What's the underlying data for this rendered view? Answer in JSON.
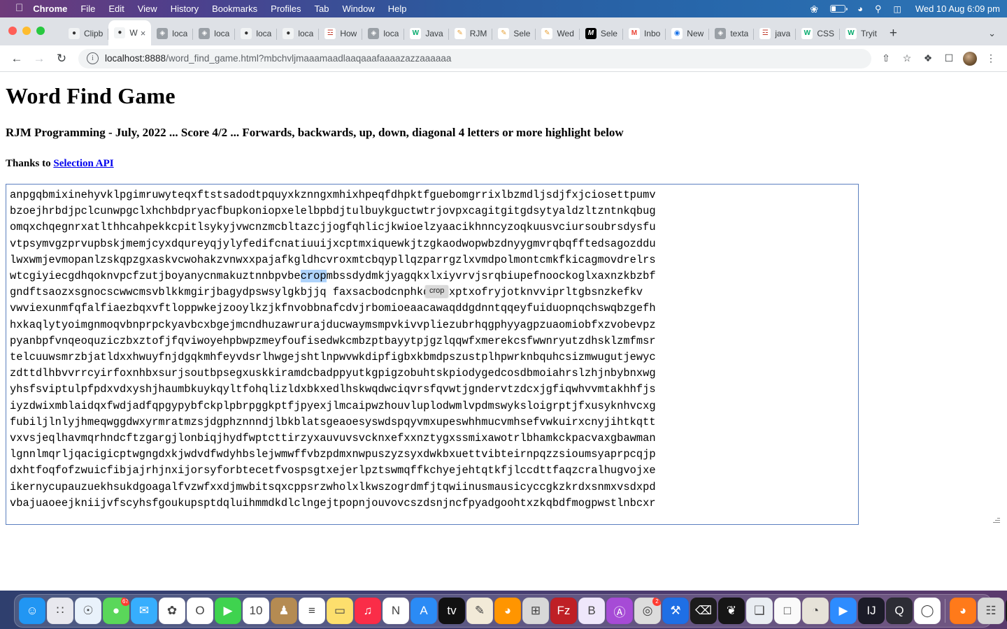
{
  "menubar": {
    "apple_icon": "apple-icon",
    "items": [
      {
        "label": "Chrome",
        "bold": true
      },
      {
        "label": "File",
        "bold": false
      },
      {
        "label": "Edit",
        "bold": false
      },
      {
        "label": "View",
        "bold": false
      },
      {
        "label": "History",
        "bold": false
      },
      {
        "label": "Bookmarks",
        "bold": false
      },
      {
        "label": "Profiles",
        "bold": false
      },
      {
        "label": "Tab",
        "bold": false
      },
      {
        "label": "Window",
        "bold": false
      },
      {
        "label": "Help",
        "bold": false
      }
    ],
    "status_icons": [
      "bluetooth-icon",
      "battery-icon",
      "wifi-icon",
      "search-icon",
      "control-center-icon"
    ],
    "clock": "Wed 10 Aug  6:09 pm"
  },
  "browser": {
    "window_controls": [
      "close",
      "minimize",
      "maximize"
    ],
    "tabs": [
      {
        "title": "Clipb",
        "favicon": "panda",
        "active": false
      },
      {
        "title": "W",
        "favicon": "panda",
        "active": true
      },
      {
        "title": "loca",
        "favicon": "globe",
        "active": false
      },
      {
        "title": "loca",
        "favicon": "globe",
        "active": false
      },
      {
        "title": "loca",
        "favicon": "panda",
        "active": false
      },
      {
        "title": "loca",
        "favicon": "panda",
        "active": false
      },
      {
        "title": "How",
        "favicon": "java",
        "active": false
      },
      {
        "title": "loca",
        "favicon": "globe",
        "active": false
      },
      {
        "title": "Java",
        "favicon": "w3schools",
        "active": false
      },
      {
        "title": "RJM",
        "favicon": "pen",
        "active": false
      },
      {
        "title": "Sele",
        "favicon": "pen",
        "active": false
      },
      {
        "title": "Wed",
        "favicon": "pen",
        "active": false
      },
      {
        "title": "Sele",
        "favicon": "medium",
        "active": false
      },
      {
        "title": "Inbo",
        "favicon": "gmail",
        "active": false
      },
      {
        "title": "New",
        "favicon": "chrome",
        "active": false
      },
      {
        "title": "texta",
        "favicon": "globe",
        "active": false
      },
      {
        "title": "java",
        "favicon": "java",
        "active": false
      },
      {
        "title": "CSS",
        "favicon": "w3schools",
        "active": false
      },
      {
        "title": "Tryit",
        "favicon": "w3schools",
        "active": false
      }
    ],
    "close_tab_label": "×",
    "new_tab_label": "+",
    "tab_list_label": "⌄",
    "nav": {
      "back": "←",
      "forward": "→",
      "reload": "↻"
    },
    "omnibox": {
      "info_icon": "ⓘ",
      "url_host": "localhost:8888",
      "url_path": "/word_find_game.html?mbchvljmaaamaadlaaqaaafaaaazazzaaaaaa"
    },
    "toolbar_icons": [
      "share-icon",
      "bookmark-star-icon",
      "extensions-puzzle-icon",
      "side-panel-icon",
      "profile-avatar",
      "menu-kebab-icon"
    ]
  },
  "page": {
    "title": "Word Find Game",
    "subtitle": "RJM Programming - July, 2022 ... Score 4/2 ... Forwards, backwards, up, down, diagonal 4 letters or more highlight below",
    "thanks_prefix": "Thanks to ",
    "thanks_link": "Selection API",
    "selection": {
      "word": "crop",
      "tooltip": "crop",
      "highlight_color": "#aed3fb"
    },
    "grid": {
      "line_count": 21,
      "lines": [
        "anpgqbmixinehyvklpgimruwyteqxftstsadodtpquyxkznngxmhixhpeqfdhpktfguebomgrrixlbzmdljsdjfxjciosettpumv",
        "bzoejhrbdjpclcunwpgclxhchbdpryacfbupkoniopxelelbpbdjtulbuykguctwtrjovpxcagitgitgdsytyaldzltzntnkqbug",
        "omqxchqegnrxatlthhcahpekkcpitlsykyjvwcnzmcbltazcjjogfqhlicjkwioelzyaacikhnncyzoqkuusvciursoubrsdysfu",
        "vtpsymvgzprvupbskjmemjcyxdqureyqjylyfedifcnatiuuijxcptmxiquewkjtzgkaodwopwbzdnyygmvrqbqfftedsagozddu",
        "lwxwmjevmopanlzskqpzgxaskvcwohakzvnwxxpajafkgldhcvroxmtcbqypllqzparrgzlxvmdpolmontcmkfkicagmovdrelrs",
        "wtcgiyiecgdhqoknvpcfzutjboyanycnmakuztnnbpvbecropmbssdydmkjyagqkxlxiyvrvjsrqbiupefnoockoglxaxnzkbzbf",
        "gndftsaozxsgnocscwwcmsvblkkmgirjbagydpswsylgkbjjq faxsacbodcnphkdntfxptxofryjotknvviprltgbsnzkefkv",
        "vwviexunmfqfalfiaezbqxvftloppwkejzooylkzjkfnvobbnafcdvjrbomioeaacawaqddgdnntqqeyfuiduopnqchswqbzgefh",
        "hxkaqlytyoimgnmoqvbnprpckyavbcxbgejmcndhuzawrurajducwaymsmpvkivvpliezubrhqgphyyagpzuaomiobfxzvobevpz",
        "pyanbpfvnqeoquziczbxztofjfqviwoyehpbwpzmeyfoufisedwkcmbzptbayytpjgzlqqwfxmerekcsfwwnryutzdhsklzmfmsr",
        "telcuuwsmrzbjatldxxhwuyfnjdgqkmhfeyvdsrlhwgejshtlnpwvwkdipfigbxkbmdpszustplhpwrknbquhcsizmwugutjewyc",
        "zdttdlhbvvrrcyirfoxnhbxsurjsoutbpsegxuskkiramdcbadppyutkgpigzobuhtskpiodygedcosdbmoiahrslzhjnbybnxwg",
        "yhsfsviptulpfpdxvdxyshjhaumbkuykqyltfohqlizldxbkxedlhskwqdwciqvrsfqvwtjgndervtzdcxjgfiqwhvvmtakhhfjs",
        "iyzdwixmblaidqxfwdjadfqpgypybfckplpbrpggkptfjpyexjlmcaipwzhouvluplodwmlvpdmswyksloigrptjfxusyknhvcxg",
        "fubiljlnlyjhmeqwggdwxyrmratmzsjdgphznnndjlbkblatsgeaoesyswdspqyvmxupeswhhmucvmhsefvwkuirxcnyjihtkqtt",
        "vxvsjeqlhavmqrhndcftzgargjlonbiqjhydfwptcttirzyxauvuvsvcknxefxxnztygxssmixawotrlbhamkckpacvaxgbawman",
        "lgnnlmqrljqacigicptwgngdxkjwdvdfwdyhbslejwmwffvbzpdmxnwpuszyzsyxdwkbxuettvibteirnpqzzsioumsyaprpcqjp",
        "dxhtfoqfofzwuicfibjajrhjnxijorsyforbtecetfvospsgtxejerlpztswmqffkchyejehtqtkfjlccdttfaqzcralhugvojxe",
        "ikernycupauzuekhsukdgoagalfvzwfxxdjmwbitsqxcppsrzwholxlkwszogrdmfjtqwiinusmausicyccgkzkrdxsnmxvsdxpd",
        "vbajuaoeejkniijvfscyhsfgoukupsptdqluihmmdkdlclngejtpopnjouvovcszdsnjncfpyadgoohtxzkqbdfmogpwstlnbcxr"
      ]
    }
  },
  "dock": {
    "apps": [
      {
        "name": "finder",
        "glyph": "☺",
        "bg": "#2196f3",
        "dot": true
      },
      {
        "name": "launchpad",
        "glyph": "∷",
        "bg": "#e8e8ee",
        "dot": false
      },
      {
        "name": "safari",
        "glyph": "☉",
        "bg": "#e9f2fb",
        "dot": false
      },
      {
        "name": "messages",
        "glyph": "●",
        "bg": "#5ad75a",
        "dot": false,
        "badge": "67"
      },
      {
        "name": "mail",
        "glyph": "✉",
        "bg": "#37aefd",
        "dot": false
      },
      {
        "name": "photos",
        "glyph": "✿",
        "bg": "#ffffff",
        "dot": false
      },
      {
        "name": "opera",
        "glyph": "O",
        "bg": "#ffffff",
        "dot": true
      },
      {
        "name": "facetime",
        "glyph": "▶",
        "bg": "#3fd34f",
        "dot": false
      },
      {
        "name": "calendar",
        "glyph": "10",
        "bg": "#ffffff",
        "dot": false
      },
      {
        "name": "contacts",
        "glyph": "♟",
        "bg": "#b58b52",
        "dot": false
      },
      {
        "name": "reminders",
        "glyph": "≡",
        "bg": "#ffffff",
        "dot": false
      },
      {
        "name": "notes",
        "glyph": "▭",
        "bg": "#fddf6d",
        "dot": false
      },
      {
        "name": "music",
        "glyph": "♫",
        "bg": "#fa2d48",
        "dot": false
      },
      {
        "name": "news",
        "glyph": "N",
        "bg": "#ffffff",
        "dot": false
      },
      {
        "name": "app-store",
        "glyph": "A",
        "bg": "#2b8bf5",
        "dot": false
      },
      {
        "name": "apple-tv",
        "glyph": "tv",
        "bg": "#111111",
        "dot": false
      },
      {
        "name": "paintbrush",
        "glyph": "✎",
        "bg": "#f2ead8",
        "dot": true
      },
      {
        "name": "firefox",
        "glyph": "◕",
        "bg": "#ff9500",
        "dot": false
      },
      {
        "name": "calculator",
        "glyph": "⊞",
        "bg": "#d8d8d8",
        "dot": false
      },
      {
        "name": "filezilla",
        "glyph": "Fz",
        "bg": "#bf2026",
        "dot": true
      },
      {
        "name": "bbedit",
        "glyph": "B",
        "bg": "#efe7fb",
        "dot": true
      },
      {
        "name": "podcasts",
        "glyph": "Ⓐ",
        "bg": "#a64bd6",
        "dot": false
      },
      {
        "name": "scanner",
        "glyph": "◎",
        "bg": "#dcdcdc",
        "dot": false,
        "badge": "2"
      },
      {
        "name": "xcode",
        "glyph": "⚒",
        "bg": "#1f6fe5",
        "dot": false
      },
      {
        "name": "terminal",
        "glyph": "⌫",
        "bg": "#1c1c1c",
        "dot": true
      },
      {
        "name": "white-elephant",
        "glyph": "❦",
        "bg": "#161616",
        "dot": true
      },
      {
        "name": "preview",
        "glyph": "❑",
        "bg": "#e9edf2",
        "dot": false
      },
      {
        "name": "textedit",
        "glyph": "□",
        "bg": "#fafafa",
        "dot": false
      },
      {
        "name": "gimp",
        "glyph": "◔",
        "bg": "#e6e2d8",
        "dot": true
      },
      {
        "name": "zoom",
        "glyph": "▶",
        "bg": "#2d8cff",
        "dot": false
      },
      {
        "name": "intellij",
        "glyph": "IJ",
        "bg": "#1c1c28",
        "dot": false
      },
      {
        "name": "quicktime",
        "glyph": "Q",
        "bg": "#2d2d35",
        "dot": false
      },
      {
        "name": "chrome",
        "glyph": "◯",
        "bg": "#ffffff",
        "dot": true
      },
      {
        "name": "firefox-2",
        "glyph": "◕",
        "bg": "#ff7a1a",
        "dot": false
      },
      {
        "name": "toolbox",
        "glyph": "☷",
        "bg": "#d6d6d6",
        "dot": false
      },
      {
        "name": "console",
        "glyph": "⎙",
        "bg": "#1b1b1b",
        "dot": false
      },
      {
        "name": "photo-file",
        "glyph": "⛰",
        "bg": "#c9d7e4",
        "dot": false
      },
      {
        "name": "doc-file-1",
        "glyph": "☰",
        "bg": "#f2f2f2",
        "dot": false
      },
      {
        "name": "doc-file-2",
        "glyph": "☰",
        "bg": "#f2f2f2",
        "dot": false
      },
      {
        "name": "downloads",
        "glyph": "●",
        "bg": "#3f4a6b",
        "dot": false
      },
      {
        "name": "trash",
        "glyph": "□",
        "bg": "#eef1f4",
        "dot": false
      }
    ]
  }
}
